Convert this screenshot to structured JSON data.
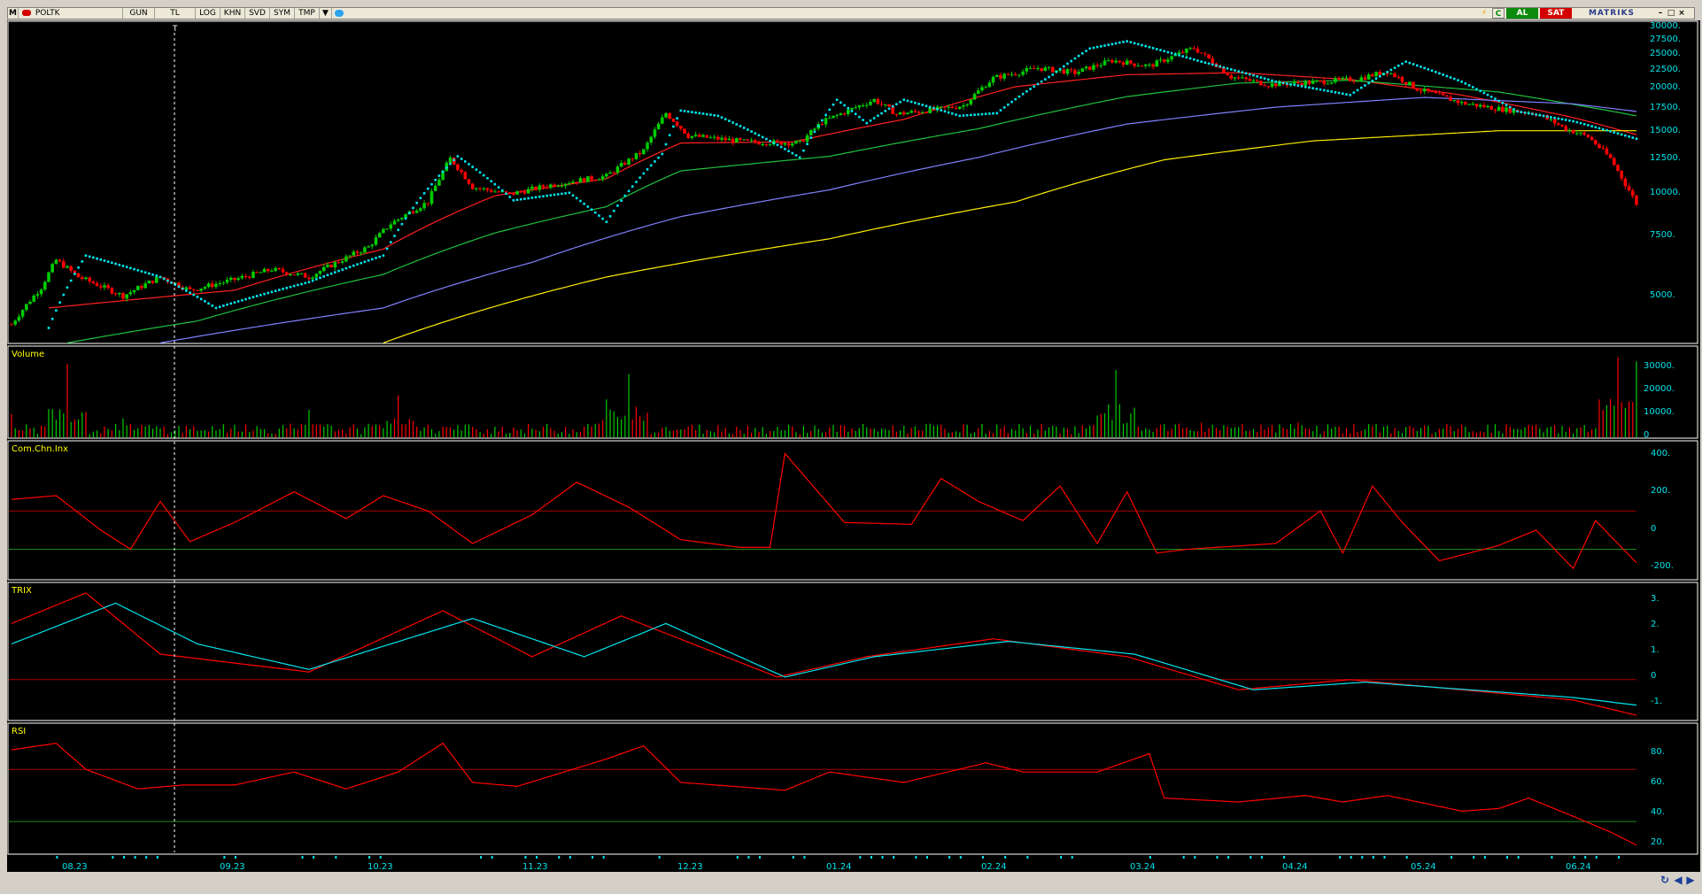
{
  "toolbar": {
    "logo": "M",
    "symbol": "POLTK",
    "period": "GUN",
    "currency": "TL",
    "buttons": [
      "LOG",
      "KHN",
      "SVD",
      "SYM",
      "TMP"
    ],
    "dropdown_icon": "triangle-down-icon",
    "share_icon": "twitter-bird-icon",
    "right_icons": [
      "lightning-icon",
      "c-icon"
    ],
    "buy": "AL",
    "sell": "SAT",
    "brand": "MATRIKS",
    "colors": {
      "buy": "#0b8a0b",
      "sell": "#d40000"
    }
  },
  "cursor_marker": "T",
  "panels": {
    "price": {
      "title": "",
      "scale": "log",
      "y_ticks": [
        "30000.",
        "27500.",
        "25000.",
        "22500.",
        "20000.",
        "17500.",
        "15000.",
        "12500.",
        "10000.",
        "7500.",
        "5000."
      ]
    },
    "volume": {
      "title": "Volume",
      "y_ticks": [
        "30000.",
        "20000.",
        "10000.",
        "0"
      ]
    },
    "cci": {
      "title": "Com.Chn.Inx",
      "y_ticks": [
        "400.",
        "200.",
        "0",
        "-200."
      ],
      "levels": [
        100,
        -100
      ]
    },
    "trix": {
      "title": "TRIX",
      "y_ticks": [
        "3.",
        "2.",
        "1.",
        "0",
        "-1."
      ],
      "levels": [
        0
      ]
    },
    "rsi": {
      "title": "RSI",
      "y_ticks": [
        "80.",
        "60.",
        "40.",
        "20."
      ],
      "levels": [
        70,
        30
      ]
    }
  },
  "x_axis": {
    "labels": [
      "08.23",
      "09.23",
      "10.23",
      "11.23",
      "12.23",
      "01.24",
      "02.24",
      "03.24",
      "04.24",
      "05.24",
      "06.24"
    ]
  },
  "colors": {
    "background": "#000000",
    "up": "#00cc00",
    "down": "#ff0000",
    "sar": "#00e5ee",
    "ma_short": "#ff2020",
    "ma_mid": "#20c040",
    "ma_long": "#8080ff",
    "ma_longest": "#ffee00",
    "axis_text": "#00e5ee",
    "title_text": "#ffff00",
    "trix_signal": "#00e5ee"
  },
  "bottom_bar": {
    "icons": [
      "refresh-icon",
      "arrow-left-icon",
      "arrow-right-icon"
    ]
  },
  "chart_data": [
    {
      "type": "candlestick",
      "title": "",
      "x_labels": [
        "08.23",
        "09.23",
        "10.23",
        "11.23",
        "12.23",
        "01.24",
        "02.24",
        "03.24",
        "04.24",
        "05.24",
        "06.24"
      ],
      "y_scale": "log",
      "ylim": [
        4000,
        31000
      ],
      "close_path": [
        [
          0,
          4400
        ],
        [
          8,
          5600
        ],
        [
          12,
          6700
        ],
        [
          18,
          6000
        ],
        [
          30,
          5300
        ],
        [
          40,
          6000
        ],
        [
          48,
          5500
        ],
        [
          60,
          5900
        ],
        [
          70,
          6300
        ],
        [
          80,
          6000
        ],
        [
          90,
          6800
        ],
        [
          96,
          7300
        ],
        [
          102,
          8500
        ],
        [
          112,
          9800
        ],
        [
          118,
          13000
        ],
        [
          124,
          10800
        ],
        [
          134,
          10300
        ],
        [
          146,
          11000
        ],
        [
          160,
          11600
        ],
        [
          170,
          13700
        ],
        [
          176,
          17500
        ],
        [
          182,
          15100
        ],
        [
          198,
          14500
        ],
        [
          212,
          14400
        ],
        [
          218,
          16500
        ],
        [
          232,
          19100
        ],
        [
          238,
          17400
        ],
        [
          250,
          18000
        ],
        [
          256,
          18400
        ],
        [
          264,
          22000
        ],
        [
          276,
          23500
        ],
        [
          286,
          22800
        ],
        [
          296,
          24700
        ],
        [
          306,
          23800
        ],
        [
          318,
          26800
        ],
        [
          328,
          22200
        ],
        [
          338,
          21100
        ],
        [
          350,
          21400
        ],
        [
          362,
          21900
        ],
        [
          370,
          23000
        ],
        [
          378,
          20500
        ],
        [
          390,
          18700
        ],
        [
          400,
          18000
        ],
        [
          410,
          17500
        ],
        [
          418,
          15800
        ],
        [
          424,
          15000
        ],
        [
          430,
          13000
        ],
        [
          434,
          11000
        ],
        [
          437,
          9700
        ]
      ],
      "moving_averages": {
        "ma_short": [
          [
            10,
            4900
          ],
          [
            60,
            5500
          ],
          [
            100,
            7200
          ],
          [
            130,
            10200
          ],
          [
            160,
            11400
          ],
          [
            180,
            14400
          ],
          [
            210,
            14500
          ],
          [
            240,
            16800
          ],
          [
            270,
            20800
          ],
          [
            300,
            22500
          ],
          [
            330,
            22800
          ],
          [
            360,
            21800
          ],
          [
            390,
            19700
          ],
          [
            420,
            17000
          ],
          [
            437,
            15200
          ]
        ],
        "ma_mid": [
          [
            15,
            3900
          ],
          [
            50,
            4500
          ],
          [
            100,
            6100
          ],
          [
            130,
            8000
          ],
          [
            160,
            9500
          ],
          [
            180,
            12000
          ],
          [
            220,
            13200
          ],
          [
            260,
            15800
          ],
          [
            300,
            19500
          ],
          [
            330,
            21300
          ],
          [
            360,
            21700
          ],
          [
            400,
            20100
          ],
          [
            437,
            17200
          ]
        ],
        "ma_long": [
          [
            40,
            3900
          ],
          [
            100,
            4900
          ],
          [
            140,
            6600
          ],
          [
            180,
            8900
          ],
          [
            220,
            10600
          ],
          [
            260,
            13100
          ],
          [
            300,
            16300
          ],
          [
            340,
            18200
          ],
          [
            380,
            19400
          ],
          [
            420,
            18600
          ],
          [
            437,
            17700
          ]
        ],
        "ma_longest": [
          [
            100,
            3900
          ],
          [
            160,
            6000
          ],
          [
            220,
            7700
          ],
          [
            270,
            9800
          ],
          [
            310,
            12900
          ],
          [
            350,
            14600
          ],
          [
            400,
            15600
          ],
          [
            437,
            15600
          ]
        ]
      },
      "sar_stops": [
        [
          10,
          4300
        ],
        [
          20,
          6900
        ],
        [
          40,
          6000
        ],
        [
          55,
          4900
        ],
        [
          80,
          5800
        ],
        [
          100,
          6900
        ],
        [
          120,
          13200
        ],
        [
          135,
          9900
        ],
        [
          150,
          10400
        ],
        [
          160,
          8600
        ],
        [
          175,
          13400
        ],
        [
          180,
          17800
        ],
        [
          190,
          17200
        ],
        [
          212,
          13100
        ],
        [
          222,
          19100
        ],
        [
          230,
          16400
        ],
        [
          240,
          19100
        ],
        [
          255,
          17200
        ],
        [
          265,
          17500
        ],
        [
          280,
          22500
        ],
        [
          290,
          26700
        ],
        [
          300,
          28000
        ],
        [
          320,
          24500
        ],
        [
          340,
          21500
        ],
        [
          360,
          19700
        ],
        [
          375,
          24500
        ],
        [
          390,
          21500
        ],
        [
          405,
          17700
        ],
        [
          420,
          16600
        ],
        [
          437,
          14800
        ]
      ]
    },
    {
      "type": "bar",
      "title": "Volume",
      "ylim": [
        0,
        40000
      ],
      "volume_spikes": [
        [
          0,
          11000
        ],
        [
          15,
          35000
        ],
        [
          30,
          9000
        ],
        [
          60,
          6000
        ],
        [
          80,
          13000
        ],
        [
          104,
          20000
        ],
        [
          160,
          18000
        ],
        [
          166,
          30000
        ],
        [
          250,
          6000
        ],
        [
          297,
          32000
        ],
        [
          320,
          7000
        ],
        [
          346,
          7000
        ],
        [
          432,
          38000
        ],
        [
          437,
          36000
        ]
      ]
    },
    {
      "type": "line",
      "title": "Com.Chn.Inx",
      "ylim": [
        -250,
        420
      ],
      "series": [
        {
          "values": [
            [
              0,
              160
            ],
            [
              12,
              180
            ],
            [
              24,
              0
            ],
            [
              32,
              -100
            ],
            [
              40,
              150
            ],
            [
              48,
              -60
            ],
            [
              60,
              40
            ],
            [
              76,
              200
            ],
            [
              90,
              60
            ],
            [
              100,
              180
            ],
            [
              112,
              100
            ],
            [
              124,
              -70
            ],
            [
              140,
              80
            ],
            [
              152,
              250
            ],
            [
              166,
              120
            ],
            [
              180,
              -50
            ],
            [
              196,
              -90
            ],
            [
              204,
              -90
            ],
            [
              208,
              400
            ],
            [
              224,
              40
            ],
            [
              242,
              30
            ],
            [
              250,
              270
            ],
            [
              260,
              150
            ],
            [
              272,
              50
            ],
            [
              282,
              230
            ],
            [
              292,
              -70
            ],
            [
              300,
              200
            ],
            [
              308,
              -120
            ],
            [
              316,
              -100
            ],
            [
              340,
              -70
            ],
            [
              352,
              100
            ],
            [
              358,
              -120
            ],
            [
              366,
              230
            ],
            [
              374,
              40
            ],
            [
              384,
              -160
            ],
            [
              400,
              -80
            ],
            [
              410,
              0
            ],
            [
              420,
              -200
            ],
            [
              426,
              50
            ],
            [
              434,
              -110
            ],
            [
              437,
              -170
            ]
          ]
        }
      ]
    },
    {
      "type": "line",
      "title": "TRIX",
      "ylim": [
        -1.5,
        3.5
      ],
      "series": [
        {
          "values": [
            [
              0,
              2.2
            ],
            [
              20,
              3.4
            ],
            [
              40,
              1.0
            ],
            [
              80,
              0.3
            ],
            [
              116,
              2.7
            ],
            [
              140,
              0.9
            ],
            [
              164,
              2.5
            ],
            [
              206,
              0.1
            ],
            [
              230,
              0.9
            ],
            [
              264,
              1.6
            ],
            [
              300,
              0.9
            ],
            [
              330,
              -0.4
            ],
            [
              360,
              0.0
            ],
            [
              420,
              -0.8
            ],
            [
              437,
              -1.4
            ]
          ]
        },
        {
          "values": [
            [
              0,
              1.4
            ],
            [
              28,
              3.0
            ],
            [
              50,
              1.4
            ],
            [
              80,
              0.4
            ],
            [
              124,
              2.4
            ],
            [
              154,
              0.9
            ],
            [
              176,
              2.2
            ],
            [
              208,
              0.1
            ],
            [
              232,
              0.9
            ],
            [
              268,
              1.5
            ],
            [
              302,
              1.0
            ],
            [
              334,
              -0.4
            ],
            [
              364,
              -0.1
            ],
            [
              420,
              -0.7
            ],
            [
              437,
              -1.0
            ]
          ]
        }
      ]
    },
    {
      "type": "line",
      "title": "RSI",
      "ylim": [
        5,
        100
      ],
      "series": [
        {
          "values": [
            [
              0,
              85
            ],
            [
              12,
              90
            ],
            [
              20,
              70
            ],
            [
              34,
              55
            ],
            [
              46,
              58
            ],
            [
              60,
              58
            ],
            [
              76,
              68
            ],
            [
              90,
              55
            ],
            [
              104,
              68
            ],
            [
              116,
              90
            ],
            [
              124,
              60
            ],
            [
              136,
              57
            ],
            [
              160,
              78
            ],
            [
              170,
              88
            ],
            [
              180,
              60
            ],
            [
              208,
              54
            ],
            [
              220,
              68
            ],
            [
              240,
              60
            ],
            [
              262,
              75
            ],
            [
              272,
              68
            ],
            [
              292,
              68
            ],
            [
              306,
              82
            ],
            [
              310,
              48
            ],
            [
              330,
              45
            ],
            [
              348,
              50
            ],
            [
              358,
              45
            ],
            [
              370,
              50
            ],
            [
              390,
              38
            ],
            [
              400,
              40
            ],
            [
              408,
              48
            ],
            [
              420,
              34
            ],
            [
              430,
              22
            ],
            [
              437,
              12
            ]
          ]
        }
      ]
    }
  ]
}
